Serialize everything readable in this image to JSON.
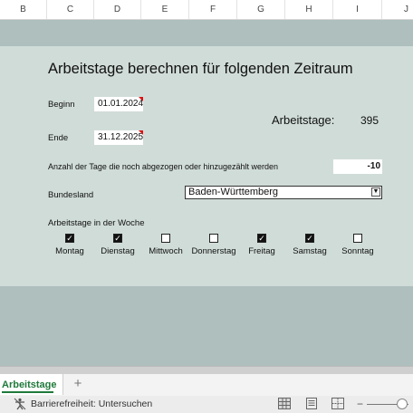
{
  "columns": [
    "B",
    "C",
    "D",
    "E",
    "F",
    "G",
    "H",
    "I",
    "J"
  ],
  "form": {
    "title": "Arbeitstage berechnen für folgenden Zeitraum",
    "beginn_label": "Beginn",
    "beginn_value": "01.01.2024",
    "ende_label": "Ende",
    "ende_value": "31.12.2025",
    "arbeitstage_label": "Arbeitstage:",
    "arbeitstage_value": "395",
    "anzahl_label": "Anzahl der Tage die noch abgezogen oder hinzugezählt werden",
    "anzahl_value": "-10",
    "bundesland_label": "Bundesland",
    "bundesland_value": "Baden-Württemberg",
    "woche_label": "Arbeitstage in der Woche",
    "days": [
      {
        "label": "Montag",
        "checked": true
      },
      {
        "label": "Dienstag",
        "checked": true
      },
      {
        "label": "Mittwoch",
        "checked": false
      },
      {
        "label": "Donnerstag",
        "checked": false
      },
      {
        "label": "Freitag",
        "checked": true
      },
      {
        "label": "Samstag",
        "checked": true
      },
      {
        "label": "Sonntag",
        "checked": false
      }
    ]
  },
  "sheet_tabs": {
    "active": "Arbeitstage",
    "add_label": "+"
  },
  "status_bar": {
    "accessibility": "Barrierefreiheit: Untersuchen"
  },
  "colors": {
    "panel": "#d0dcd8",
    "band": "#aebfbd",
    "tab_accent": "#1f7a3a",
    "comment_flag": "#dd1111"
  }
}
